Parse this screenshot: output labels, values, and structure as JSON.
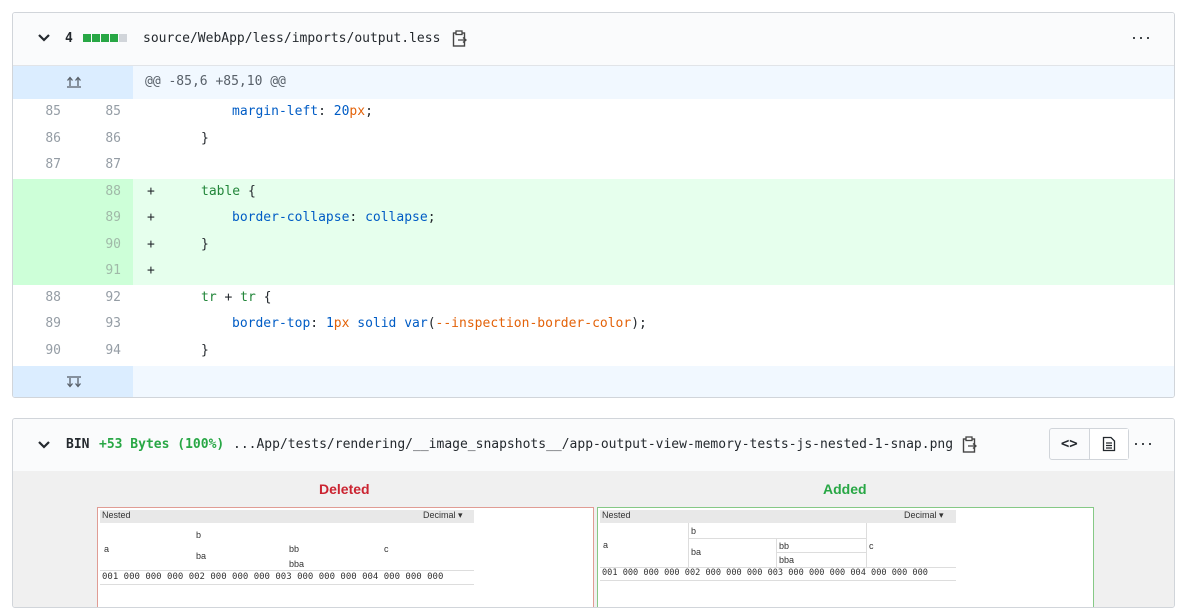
{
  "file1": {
    "changes_count": "4",
    "diffstat": {
      "added": 4,
      "neutral": 1
    },
    "path": "source/WebApp/less/imports/output.less",
    "hunk_header": "@@ -85,6 +85,10 @@",
    "lines": [
      {
        "old": "85",
        "new": "85",
        "marker": "",
        "type": "ctx"
      },
      {
        "old": "86",
        "new": "86",
        "marker": "",
        "type": "ctx"
      },
      {
        "old": "87",
        "new": "87",
        "marker": "",
        "type": "ctx"
      },
      {
        "old": "",
        "new": "88",
        "marker": "+",
        "type": "add"
      },
      {
        "old": "",
        "new": "89",
        "marker": "+",
        "type": "add"
      },
      {
        "old": "",
        "new": "90",
        "marker": "+",
        "type": "add"
      },
      {
        "old": "",
        "new": "91",
        "marker": "+",
        "type": "add"
      },
      {
        "old": "88",
        "new": "92",
        "marker": "",
        "type": "ctx"
      },
      {
        "old": "89",
        "new": "93",
        "marker": "",
        "type": "ctx"
      },
      {
        "old": "90",
        "new": "94",
        "marker": "",
        "type": "ctx"
      }
    ],
    "code": {
      "l0_prop": "margin-left",
      "l0_colon": ": ",
      "l0_num": "20",
      "l0_unit": "px",
      "l0_semi": ";",
      "l1": "}",
      "l3_sel": "table",
      "l3_brace": " {",
      "l4_prop": "border-collapse",
      "l4_colon": ": ",
      "l4_val": "collapse",
      "l4_semi": ";",
      "l5": "}",
      "l7_sel1": "tr",
      "l7_plus": " + ",
      "l7_sel2": "tr",
      "l7_brace": " {",
      "l8_prop": "border-top",
      "l8_colon": ": ",
      "l8_num": "1",
      "l8_unit": "px",
      "l8_sp": " ",
      "l8_solid": "solid",
      "l8_sp2": " ",
      "l8_var": "var",
      "l8_open": "(",
      "l8_arg": "--inspection-border-color",
      "l8_close": ");",
      "l9": "}"
    },
    "more_label": "···"
  },
  "file2": {
    "bin_label": "BIN",
    "bytes_label": "+53 Bytes (100%)",
    "path": "...App/tests/rendering/__image_snapshots__/app-output-view-memory-tests-js-nested-1-snap.png",
    "code_view_label": "<>",
    "more_label": "···",
    "deleted_label": "Deleted",
    "added_label": "Added",
    "snapshot": {
      "title": "Nested",
      "mode": "Decimal ▾",
      "a": "a",
      "b": "b",
      "ba": "ba",
      "bb": "bb",
      "bba": "bba",
      "c": "c",
      "row_deleted": "001 000 000 000 002 000 000 000 003 000 000 000 004 000 000 000",
      "row_added": "001 000 000 000 002 000 000 000 003 000 000 000 004 000 000 000"
    }
  }
}
